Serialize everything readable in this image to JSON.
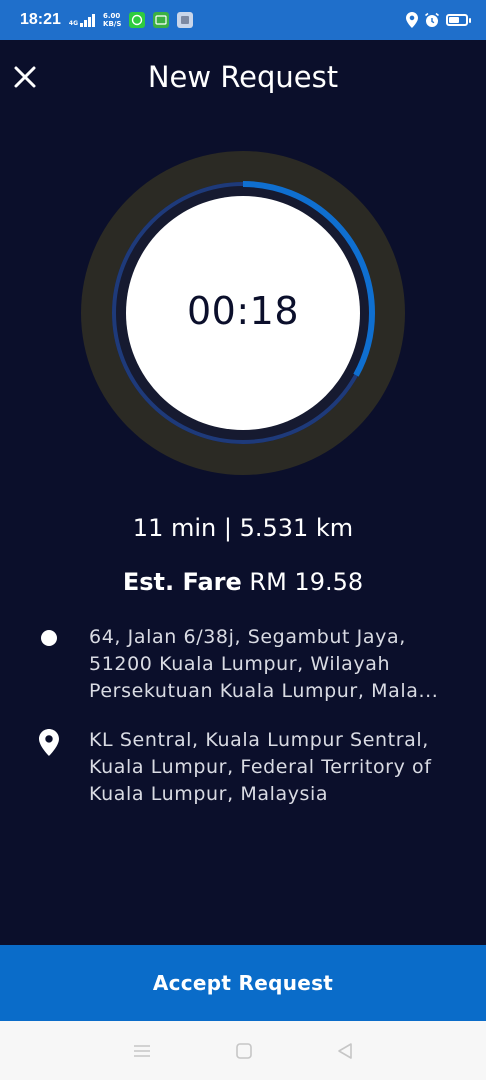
{
  "status_bar": {
    "time": "18:21",
    "network": "4G",
    "speed_value": "6.00",
    "speed_unit": "KB/S",
    "icons": [
      "signal-icon",
      "whatsapp-icon",
      "app-icon",
      "app-icon",
      "location-icon",
      "alarm-icon",
      "battery-icon"
    ]
  },
  "header": {
    "title": "New Request",
    "close_icon": "close-icon"
  },
  "timer": {
    "display": "00:18",
    "progress_fraction": 0.33,
    "colors": {
      "outer_ring": "#2b2a24",
      "track": "#1e3a7a",
      "progress": "#0f6fd0",
      "face": "#ffffff"
    }
  },
  "trip": {
    "summary": "11 min | 5.531 km",
    "fare_label": "Est. Fare",
    "fare_value": "RM 19.58"
  },
  "pickup": {
    "icon": "pickup-dot-icon",
    "address": "64, Jalan 6/38j, Segambut Jaya,\n51200 Kuala Lumpur, Wilayah\nPersekutuan Kuala Lumpur, Mala..."
  },
  "dropoff": {
    "icon": "location-pin-icon",
    "address": "KL Sentral, Kuala Lumpur Sentral,\nKuala Lumpur, Federal Territory of\nKuala Lumpur, Malaysia"
  },
  "actions": {
    "accept_label": "Accept Request"
  },
  "colors": {
    "background": "#0b0f2b",
    "status_bar": "#1f6fcb",
    "accept_button": "#0a6cc9"
  },
  "nav_bar": {
    "icons": [
      "menu-icon",
      "home-square-icon",
      "back-triangle-icon"
    ]
  }
}
